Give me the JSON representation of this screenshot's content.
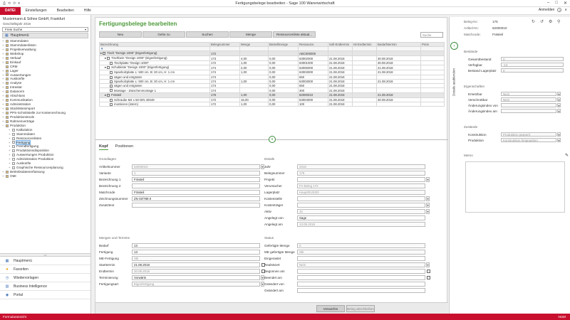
{
  "window": {
    "title": "Fertigungsbelege bearbeiten - Sage 100 Warenwirtschaft",
    "qat": [
      "⎙",
      "⟲",
      "⟳",
      "▾"
    ],
    "controls": [
      "–",
      "□",
      "✕"
    ]
  },
  "menubar": {
    "file": "DATEI",
    "items": [
      "Einstellungen",
      "Bearbeiten",
      "Hilfe"
    ],
    "login": "Anmelden"
  },
  "sidebar": {
    "company": "Mustermann & Söhne GmbH, Frankfurt",
    "fiscal": "Geschäftsjahr 2018",
    "search": "Freie Suche",
    "main": "Hauptmenü",
    "tree": [
      {
        "l": "Stammdaten",
        "d": 0,
        "e": "+"
      },
      {
        "l": "Stammdatenlisten",
        "d": 0,
        "e": "+"
      },
      {
        "l": "Projektverwaltung",
        "d": 0,
        "e": "+"
      },
      {
        "l": "Webshop",
        "d": 0,
        "e": "+"
      },
      {
        "l": "Verkauf",
        "d": 0,
        "e": "+"
      },
      {
        "l": "Einkauf",
        "d": 0,
        "e": "+"
      },
      {
        "l": "CRM",
        "d": 0,
        "e": ""
      },
      {
        "l": "Lager",
        "d": 0,
        "e": "+"
      },
      {
        "l": "Auswertungen",
        "d": 0,
        "e": "+"
      },
      {
        "l": "Auskünfte",
        "d": 0,
        "e": "+"
      },
      {
        "l": "Analyse",
        "d": 0,
        "e": "+"
      },
      {
        "l": "Intrastat",
        "d": 0,
        "e": "+"
      },
      {
        "l": "Datanorm",
        "d": 0,
        "e": "+"
      },
      {
        "l": "Abschluss",
        "d": 0,
        "e": "+"
      },
      {
        "l": "Kommunikation",
        "d": 0,
        "e": "+"
      },
      {
        "l": "Administration",
        "d": 0,
        "e": "+"
      },
      {
        "l": "Stücklistenimport",
        "d": 0,
        "e": "+"
      },
      {
        "l": "PPS-Schnittstelle zur Kostenrechnung",
        "d": 0,
        "e": "+"
      },
      {
        "l": "Produktionstools",
        "d": 0,
        "e": "+"
      },
      {
        "l": "Rahmenverträge",
        "d": 0,
        "e": "+"
      },
      {
        "l": "Produktion",
        "d": 0,
        "e": "−"
      },
      {
        "l": "Kalkulation",
        "d": 1,
        "e": "+"
      },
      {
        "l": "Stammdaten",
        "d": 1,
        "e": "+"
      },
      {
        "l": "Ressourcenlisten",
        "d": 1,
        "e": "+"
      },
      {
        "l": "Fertigung",
        "d": 1,
        "e": "+",
        "sel": true
      },
      {
        "l": "Fremdfertigung",
        "d": 1,
        "e": "+"
      },
      {
        "l": "Produktionsdisposition",
        "d": 1,
        "e": "+"
      },
      {
        "l": "Auswertungen Produktion",
        "d": 1,
        "e": "+"
      },
      {
        "l": "Administration Produktion",
        "d": 1,
        "e": "+"
      },
      {
        "l": "Auskünfte",
        "d": 1,
        "e": "+"
      },
      {
        "l": "Graphische Ressourcenplanung",
        "d": 1,
        "e": "+"
      },
      {
        "l": "Betriebsdatenerfassung",
        "d": 0,
        "e": "+"
      },
      {
        "l": "OMI",
        "d": 0,
        "e": "+"
      }
    ],
    "nav": [
      {
        "l": "Hauptmenü",
        "i": "▦",
        "c": "#3b6fb6"
      },
      {
        "l": "Favoriten",
        "i": "★",
        "c": "#e8a400"
      },
      {
        "l": "Wiedervorlagen",
        "i": "◷",
        "c": "#3b6fb6"
      },
      {
        "l": "Business Intelligence",
        "i": "▥",
        "c": "#3b6fb6"
      },
      {
        "l": "Portal",
        "i": "◉",
        "c": "#3b6fb6"
      }
    ]
  },
  "content": {
    "title": "Fertigungsbelege bearbeiten",
    "buttons": [
      "Neu",
      "Gehe zu",
      "Suchen",
      "Menge",
      "Ressourcenliste aktual..."
    ],
    "search": "Suche",
    "columns": [
      "Bezeichnung",
      "Belegnummer",
      "Menge",
      "Bestellmenge",
      "Ressource",
      "Soll-Endtermin",
      "Ist-Endtermin",
      "Bedarfstermin",
      "Preis"
    ],
    "rows": [
      {
        "indent": 0,
        "label": "Tisch \"Design 1000\" (Eigenfertigung)",
        "c": [
          "172",
          "",
          "",
          "ABC000000",
          "",
          "",
          "",
          ""
        ],
        "hl": true
      },
      {
        "indent": 1,
        "label": "Tischbein \"Design 1000\" (Eigenfertigung)",
        "c": [
          "173",
          "4,00",
          "0,00",
          "63002000",
          "21.08.2018",
          "",
          "30.08.2018",
          ""
        ]
      },
      {
        "indent": 2,
        "label": "Tischplatte \"Design 1000\"",
        "c": [
          "172",
          "1,00",
          "0,00",
          "63001000",
          "21.08.2018",
          "",
          "30.08.2018",
          ""
        ]
      },
      {
        "indent": 1,
        "label": "Schubkiste \"Design 1000\" (Eigenfertigung)",
        "c": [
          "174",
          "2,00",
          "0,00",
          "63006000",
          "21.08.2018",
          "",
          "21.08.2018",
          ""
        ]
      },
      {
        "indent": 2,
        "label": "Spanholzplatte L: 500 cm, B: 20 cm, H: 1 cm",
        "c": [
          "174",
          "1,00",
          "0,00",
          "63003000",
          "21.08.2018",
          "",
          "21.08.2018",
          ""
        ]
      },
      {
        "indent": 2,
        "label": "sägen und entgraten",
        "c": [
          "174",
          "",
          "0,00",
          "650",
          "21.08.2018",
          "",
          "",
          ""
        ]
      },
      {
        "indent": 2,
        "label": "Spanholzplatte L: 500 cm, B: 20 cm, H: 1 cm",
        "c": [
          "174",
          "1,00",
          "0,00",
          "63003000",
          "21.08.2018",
          "",
          "21.08.2018",
          ""
        ]
      },
      {
        "indent": 2,
        "label": "sägen und entgraten",
        "c": [
          "174",
          "",
          "0,00",
          "650",
          "21.08.2018",
          "",
          "",
          ""
        ]
      },
      {
        "indent": 2,
        "label": "Montage - Zwischenmontage 1",
        "c": [
          "174",
          "",
          "0,00",
          "300",
          "21.08.2018",
          "",
          "",
          ""
        ]
      },
      {
        "indent": 1,
        "label": "Frästeil",
        "c": [
          "175",
          "1,00",
          "0,00",
          "62000010",
          "21.08.2018",
          "",
          "21.08.2018",
          ""
        ],
        "hl": true
      },
      {
        "indent": 2,
        "label": "Schraube M4 x 50 DIN 40049",
        "c": [
          "172",
          "16,00",
          "0,00",
          "63004000",
          "21.08.2018",
          "",
          "30.08.2018",
          ""
        ]
      },
      {
        "indent": 2,
        "label": "montieren (intern)",
        "c": [
          "172",
          "1,00",
          "0,00",
          "100",
          "21.08.2018",
          "",
          "",
          ""
        ]
      }
    ],
    "tabs": [
      "Kopf",
      "Positionen"
    ],
    "grundlagen": {
      "title": "Grundlagen",
      "fields": [
        {
          "l": "Artikelnummer",
          "v": "62000010",
          "dis": true,
          "dd": true
        },
        {
          "l": "Variante",
          "v": "1",
          "dis": true
        },
        {
          "l": "Bezeichnung 1",
          "v": "Frästeil"
        },
        {
          "l": "Bezeichnung 2",
          "v": ""
        },
        {
          "l": "Matchcode",
          "v": "Frästeil"
        },
        {
          "l": "Zeichnungsnummer",
          "v": "ZN 02/789.0"
        },
        {
          "l": "Zusatztext",
          "v": ""
        }
      ]
    },
    "details": {
      "title": "Details",
      "fields": [
        {
          "l": "Jahr",
          "v": "2018",
          "dis": true
        },
        {
          "l": "Belegnummer",
          "v": "175",
          "dis": true
        },
        {
          "l": "Projekt",
          "v": "",
          "dd": true
        },
        {
          "l": "Verursacher",
          "v": "FA-Beleg 172",
          "dis": true
        },
        {
          "l": "Lagerplatz",
          "v": "Haupt/01/03/3",
          "dis": true
        },
        {
          "l": "Kostenstelle",
          "v": "",
          "dd": true
        },
        {
          "l": "Kostenträger",
          "v": "",
          "dd": true
        },
        {
          "l": "Aktiv",
          "v": "Ja",
          "dis": true,
          "dd": true
        },
        {
          "l": "Angelegt von",
          "v": "Sage"
        },
        {
          "l": "Angelegt am",
          "v": "13.08.2018",
          "dis": true
        }
      ]
    },
    "mengen": {
      "title": "Mengen und Termine",
      "fields": [
        {
          "l": "Bedarf",
          "v": "13"
        },
        {
          "l": "Fertigung",
          "v": "13"
        },
        {
          "l": "ME-Fertigung",
          "v": "Stk",
          "dis": true
        },
        {
          "l": "Starttermin",
          "v": "21.08.2018",
          "cal": true
        },
        {
          "l": "Endtermin",
          "v": "30.08.2018",
          "dis": true,
          "cal": true
        },
        {
          "l": "Terminierung",
          "v": "Vorwärts",
          "dd": true
        },
        {
          "l": "Fertigungsart",
          "v": "Eigenfertigung",
          "dis": true,
          "dd": true
        }
      ]
    },
    "status": {
      "title": "Status",
      "fields": [
        {
          "l": "Gefertigte Menge",
          "v": "0",
          "dis": true
        },
        {
          "l": "ME gefertigte Menge",
          "v": "Stk",
          "dis": true
        },
        {
          "l": "Eingerastet",
          "v": ""
        },
        {
          "l": "Realstviert",
          "v": "Nein",
          "dis": true,
          "dd": true
        },
        {
          "l": "Begonnen am",
          "v": "",
          "cal": true
        },
        {
          "l": "Beendet am",
          "v": "",
          "cal": true
        },
        {
          "l": "Geändert von",
          "v": ""
        },
        {
          "l": "Geändert am",
          "v": ""
        }
      ]
    },
    "bottom": {
      "confirm": "Verwerfen",
      "close": "Beleg abschließen"
    }
  },
  "right": {
    "top": [
      {
        "l": "Beleg-Nr.:",
        "v": "175"
      },
      {
        "l": "Artikel-Nr.:",
        "v": "62000010"
      },
      {
        "l": "Matchcode:",
        "v": "Frästeil"
      }
    ],
    "sidetab": "Details ausblenden",
    "bestaende": {
      "title": "Bestände",
      "fields": [
        {
          "l": "Gesamtbestand",
          "v": "0"
        },
        {
          "l": "Verfügbar",
          "v": "-13"
        },
        {
          "l": "Bestand Lagerplatz",
          "v": "0"
        }
      ]
    },
    "eigenschaften": {
      "title": "Eigenschaften",
      "fields": [
        {
          "l": "Ersetzbar",
          "v": "Nein"
        },
        {
          "l": "Verschrottbar",
          "v": "Nein"
        },
        {
          "l": "Änderungsindex von",
          "v": ""
        },
        {
          "l": "Änderungsindex am",
          "v": ""
        }
      ]
    },
    "zustaende": {
      "title": "Zustände",
      "fields": [
        {
          "l": "Konstruktion",
          "v": "Produktion gesperrt"
        },
        {
          "l": "Produktion",
          "v": "Konstruktion freigegeben"
        }
      ]
    },
    "notiz": {
      "title": "Memo"
    }
  },
  "statusbar": {
    "left": "Formularansicht",
    "right": "NUM"
  }
}
